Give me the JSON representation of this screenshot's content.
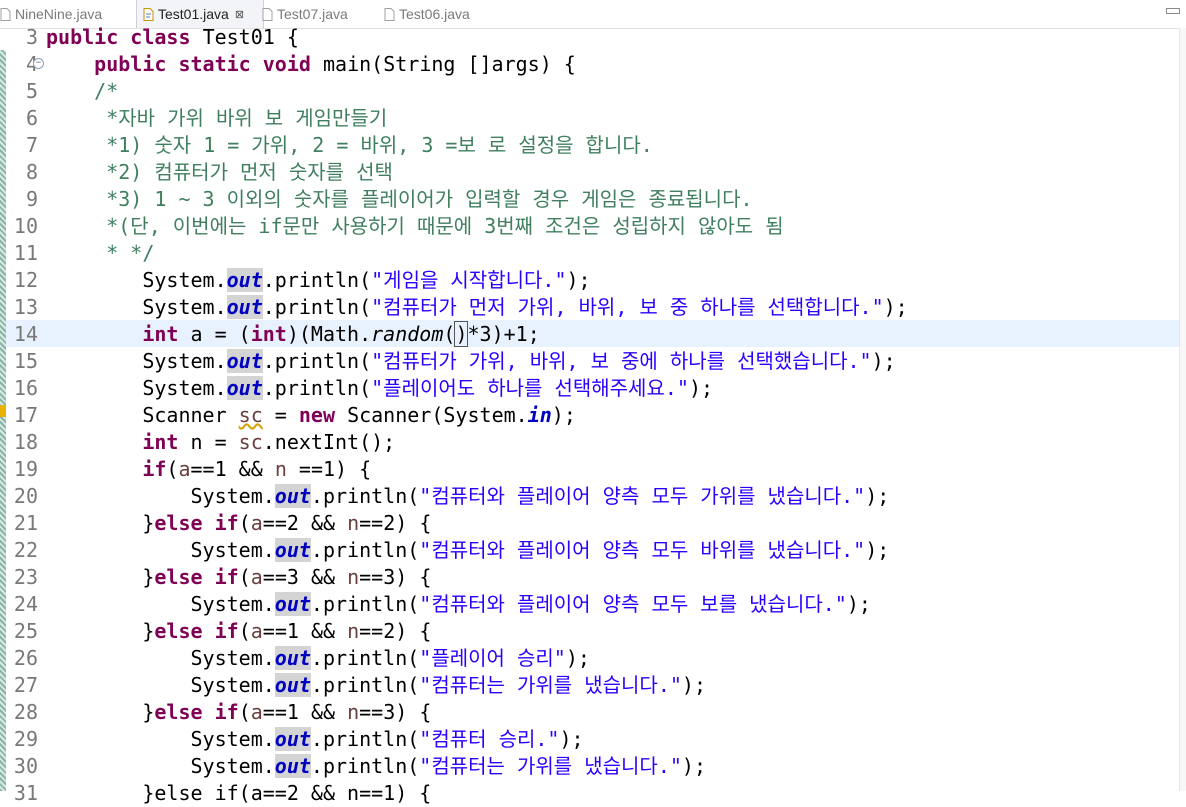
{
  "tabs": [
    {
      "label": "NineNine.java",
      "active": false
    },
    {
      "label": "Test01.java",
      "active": true,
      "close": "⊠"
    },
    {
      "label": "Test07.java",
      "active": false
    },
    {
      "label": "Test06.java",
      "active": false
    }
  ],
  "editor": {
    "current_line": 14,
    "lines": [
      {
        "n": "3"
      },
      {
        "n": "4"
      },
      {
        "n": "5"
      },
      {
        "n": "6"
      },
      {
        "n": "7"
      },
      {
        "n": "8"
      },
      {
        "n": "9"
      },
      {
        "n": "10"
      },
      {
        "n": "11"
      },
      {
        "n": "12"
      },
      {
        "n": "13"
      },
      {
        "n": "14"
      },
      {
        "n": "15"
      },
      {
        "n": "16"
      },
      {
        "n": "17"
      },
      {
        "n": "18"
      },
      {
        "n": "19"
      },
      {
        "n": "20"
      },
      {
        "n": "21"
      },
      {
        "n": "22"
      },
      {
        "n": "23"
      },
      {
        "n": "24"
      },
      {
        "n": "25"
      },
      {
        "n": "26"
      },
      {
        "n": "27"
      },
      {
        "n": "28"
      },
      {
        "n": "29"
      },
      {
        "n": "30"
      },
      {
        "n": "31"
      }
    ],
    "tokens": {
      "public": "public",
      "class": "class",
      "class_name": "Test01",
      "static": "static",
      "void": "void",
      "main_sig": "main(String []args)",
      "c0": "/*",
      "c1": "*자바 가위 바위 보 게임만들기",
      "c2": "*1) 숫자 1 = 가위, 2 = 바위, 3 =보 로 설정을 합니다.",
      "c3": "*2) 컴퓨터가 먼저 숫자를 선택",
      "c4": "*3) 1 ~ 3 이외의 숫자를 플레이어가 입력할 경우 게임은 종료됩니다.",
      "c5": "*(단, 이번에는 if문만 사용하기 때문에 3번째 조건은 성립하지 않아도 됨",
      "c6": "* */",
      "system": "System",
      "out": "out",
      "println": ".println(",
      "s1": "\"게임을 시작합니다.\"",
      "s2": "\"컴퓨터가 먼저 가위, 바위, 보 중 하나를 선택합니다.\"",
      "int": "int",
      "math": "Math",
      "random": "random",
      "s3": "\"컴퓨터가 가위, 바위, 보 중에 하나를 선택했습니다.\"",
      "s4": "\"플레이어도 하나를 선택해주세요.\"",
      "scanner": "Scanner",
      "new": "new",
      "in": "in",
      "next_int": ".nextInt();",
      "if": "if",
      "else": "else",
      "s5": "\"컴퓨터와 플레이어 양측 모두 가위를 냈습니다.\"",
      "s6": "\"컴퓨터와 플레이어 양측 모두 바위를 냈습니다.\"",
      "s7": "\"컴퓨터와 플레이어 양측 모두 보를 냈습니다.\"",
      "s8": "\"플레이어 승리\"",
      "s9": "\"컴퓨터는 가위를 냈습니다.\"",
      "s10": "\"컴퓨터 승리.\"",
      "s11": "\"컴퓨터는 가위를 냈습니다.\"",
      "partial31": "}else if(a==2 && n==1) {"
    }
  },
  "colors": {
    "keyword": "#7f0055",
    "comment": "#3f7f5f",
    "string": "#2a00ff",
    "field": "#0000c0",
    "current_line": "#e8f2fe",
    "line_number": "#787878"
  },
  "icons": {
    "file": "java-file-icon",
    "fold": "fold-collapse-icon",
    "warning": "warning-marker-icon"
  }
}
